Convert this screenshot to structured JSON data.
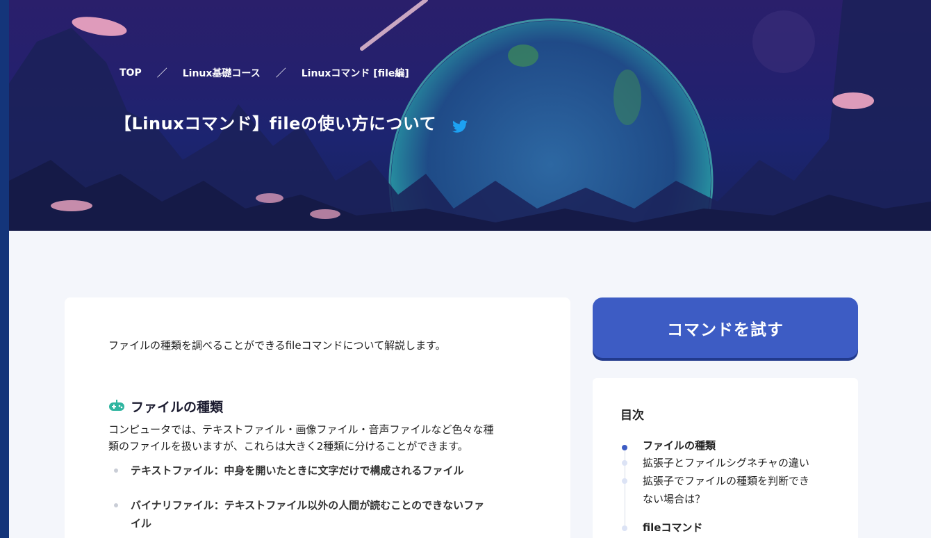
{
  "breadcrumb": {
    "items": [
      "TOP",
      "Linux基礎コース",
      "Linuxコマンド [file編]"
    ],
    "separator": "／"
  },
  "header": {
    "title": "【Linuxコマンド】fileの使い方について",
    "share_icon": "twitter-icon"
  },
  "article": {
    "intro": "ファイルの種類を調べることができるfileコマンドについて解説します。",
    "section_icon": "gamepad-icon",
    "section_title": "ファイルの種類",
    "paragraph_line1": "コンピュータでは、テキストファイル・画像ファイル・音声ファイルなど色々な種",
    "paragraph_line2": "類のファイルを扱いますが、これらは大きく2種類に分けることができます。",
    "bullets": [
      "テキストファイル：中身を開いたときに文字だけで構成されるファイル",
      "バイナリファイル：テキストファイル以外の人間が読むことのできないファ",
      "イル"
    ]
  },
  "sidebar": {
    "try_button": "コマンドを試す",
    "toc_title": "目次",
    "toc_items": [
      "ファイルの種類",
      "拡張子とファイルシグネチャの違い",
      "拡張子でファイルの種類を判断でき",
      "ない場合は？",
      "fileコマンド"
    ]
  },
  "colors": {
    "accent": "#3d5cc4",
    "hero_bg": "#24206e",
    "twitter": "#1da1f2"
  }
}
